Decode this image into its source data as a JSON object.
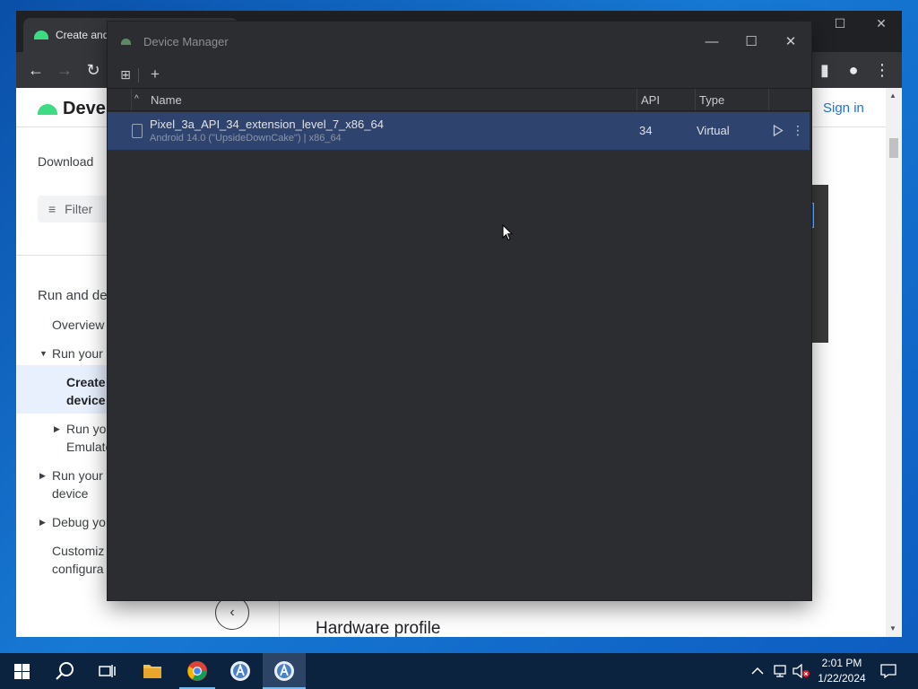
{
  "chrome": {
    "tab_title": "Create and",
    "page": {
      "site_name": "Devel",
      "sign_in": "Sign in",
      "download": "Download",
      "filter_placeholder": "Filter",
      "hardware_profile": "Hardware profile",
      "nav": {
        "run_and_debug": "Run and de",
        "overview": "Overview",
        "run_your_app": "Run your a",
        "create_line1": "Create",
        "create_line2": "device",
        "run_emulator_line1": "Run you",
        "run_emulator_line2": "Emulato",
        "run_device_line1": "Run your a",
        "run_device_line2": "device",
        "debug": "Debug yo",
        "customize_line1": "Customiz",
        "customize_line2": "configura"
      }
    }
  },
  "device_manager": {
    "window_title": "Device Manager",
    "columns": {
      "name": "Name",
      "api": "API",
      "type": "Type"
    },
    "devices": [
      {
        "name": "Pixel_3a_API_34_extension_level_7_x86_64",
        "subtitle": "Android 14.0 (\"UpsideDownCake\") | x86_64",
        "api": "34",
        "type": "Virtual"
      }
    ]
  },
  "taskbar": {
    "time": "2:01 PM",
    "date": "1/22/2024"
  },
  "colors": {
    "dm_bg": "#2b2d30",
    "dm_selected_row": "#2e436e",
    "android_green": "#3ddc84",
    "link_blue": "#1a73e8",
    "taskbar_bg": "#0c2340"
  }
}
